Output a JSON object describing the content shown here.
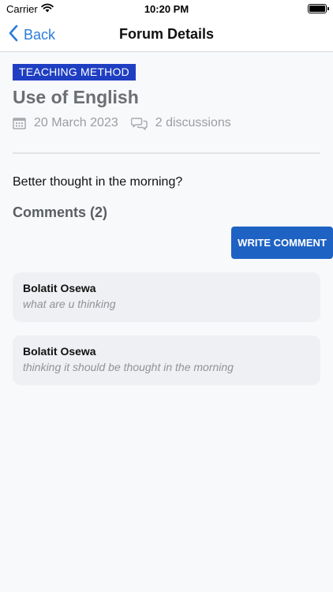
{
  "status_bar": {
    "carrier": "Carrier",
    "time": "10:20 PM"
  },
  "nav": {
    "back_label": "Back",
    "title": "Forum Details"
  },
  "forum": {
    "category": "TEACHING METHOD",
    "title": "Use of English",
    "date": "20 March 2023",
    "discussions": "2 discussions",
    "question": "Better thought in the morning?"
  },
  "comments": {
    "heading": "Comments (2)",
    "write_label": "WRITE COMMENT",
    "items": [
      {
        "author": "Bolatit Osewa",
        "text": "what are u thinking"
      },
      {
        "author": "Bolatit Osewa",
        "text": "thinking it should be thought in the morning"
      }
    ]
  },
  "colors": {
    "accent": "#2b7bd9",
    "badge": "#1f3fc2",
    "button": "#1e62c4",
    "background": "#f8f9fb"
  },
  "icons": {
    "back": "chevron-left-icon",
    "date": "calendar-icon",
    "discussions": "chat-bubbles-icon",
    "signal": "wifi-icon",
    "battery": "battery-icon"
  }
}
